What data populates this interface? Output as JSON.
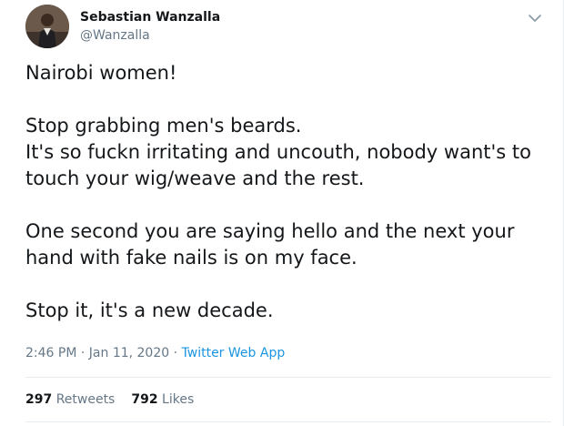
{
  "author": {
    "display_name": "Sebastian Wanzalla",
    "handle": "@Wanzalla"
  },
  "tweet": {
    "text": "Nairobi women!\n\nStop grabbing men's beards.\nIt's so fuckn irritating and uncouth, nobody want's to\ntouch your wig/weave and the rest.\n\nOne second you are saying hello and the next your\nhand with fake nails is on my face.\n\nStop it, it's a new decade.",
    "time": "2:46 PM",
    "separator1": " · ",
    "date": "Jan 11, 2020",
    "separator2": " · ",
    "source": "Twitter Web App"
  },
  "stats": {
    "retweets_count": "297",
    "retweets_label": "Retweets",
    "likes_count": "792",
    "likes_label": "Likes"
  },
  "icons": {
    "caret": "chevron-down-icon"
  },
  "colors": {
    "text": "#14171a",
    "secondary": "#657786",
    "link": "#1b95e0",
    "divider": "#e6ecf0"
  }
}
